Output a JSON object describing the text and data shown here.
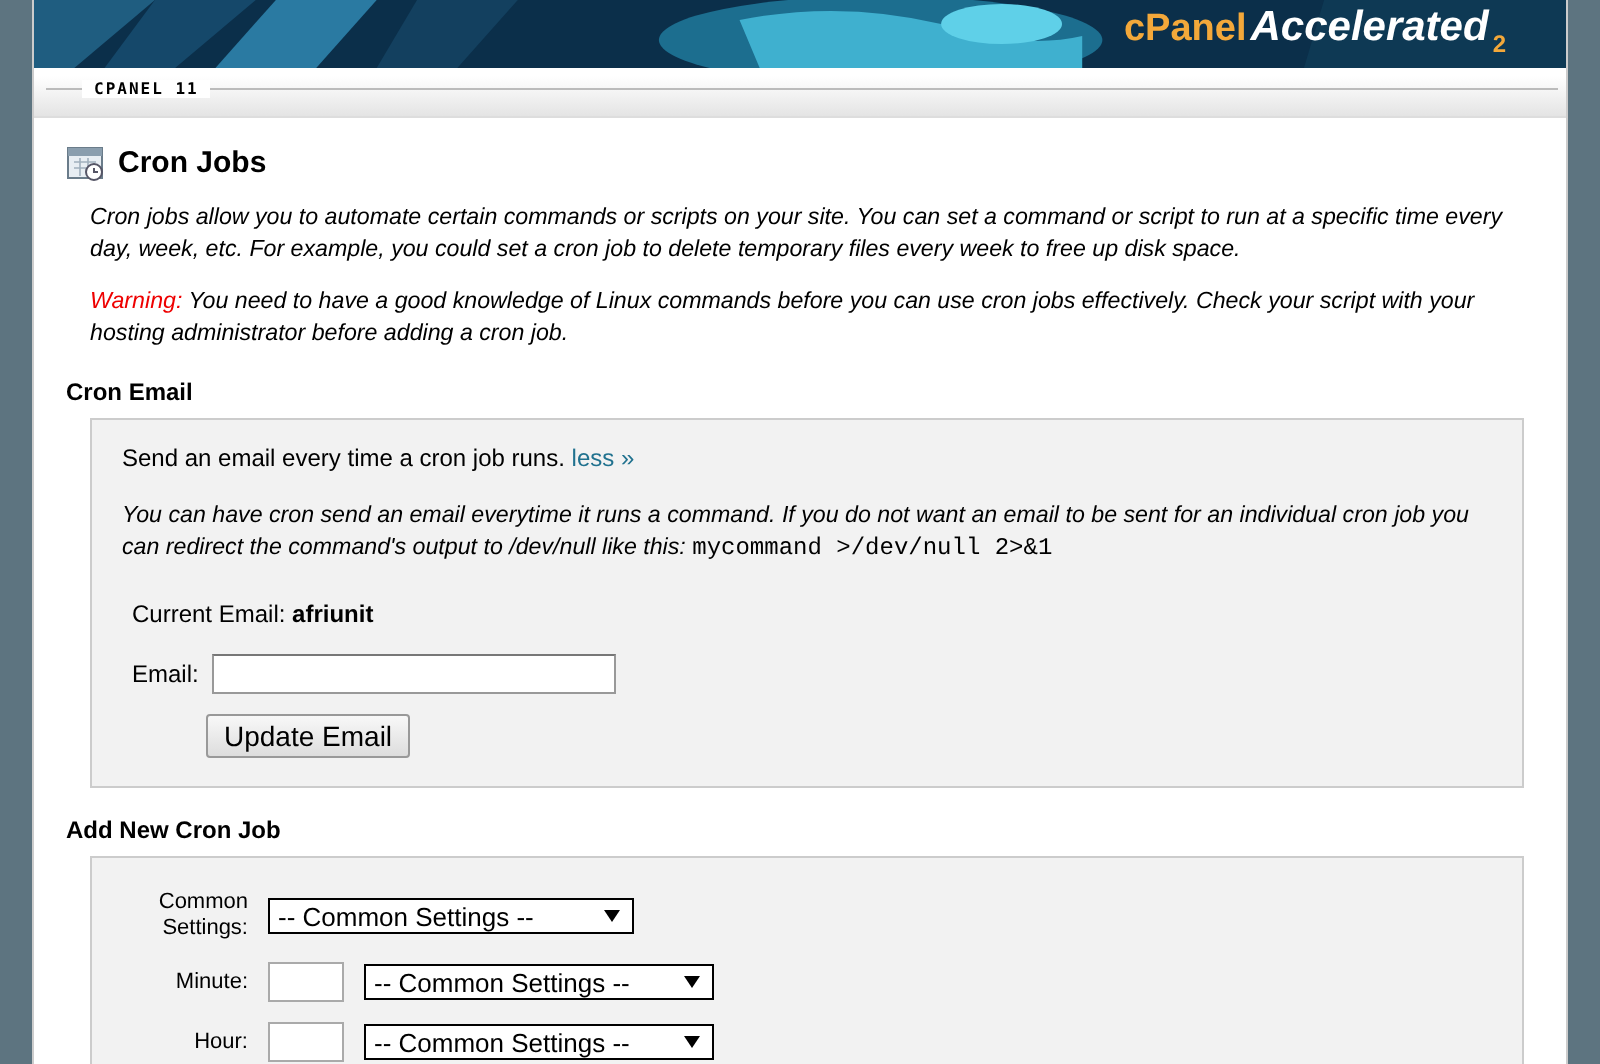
{
  "banner": {
    "brand": "cPanel",
    "product": "Accelerated",
    "version": "2"
  },
  "breadcrumb": "CPANEL 11",
  "page": {
    "title": "Cron Jobs",
    "intro": "Cron jobs allow you to automate certain commands or scripts on your site. You can set a command or script to run at a specific time every day, week, etc. For example, you could set a cron job to delete temporary files every week to free up disk space.",
    "warning_label": "Warning:",
    "warning_text": "You need to have a good knowledge of Linux commands before you can use cron jobs effectively. Check your script with your hosting administrator before adding a cron job."
  },
  "cron_email": {
    "heading": "Cron Email",
    "summary": "Send an email every time a cron job runs.",
    "toggle_link": "less »",
    "help_text": "You can have cron send an email everytime it runs a command. If you do not want an email to be sent for an individual cron job you can redirect the command's output to /dev/null like this:",
    "help_code": "mycommand >/dev/null 2>&1",
    "current_email": "Current Email: **afriunit**",
    "email_label": "Email:",
    "button": "Update Email"
  },
  "add_cron_job": {
    "heading": "Add New Cron Job",
    "rows": [
      {
        "kind": "select",
        "label": "Common Settings:",
        "select": "-- Common Settings --"
      },
      {
        "kind": "input_select",
        "label": "Minute:",
        "select": "-- Common Settings --"
      },
      {
        "kind": "input_select",
        "label": "Hour:",
        "select": "-- Common Settings --"
      }
    ]
  }
}
